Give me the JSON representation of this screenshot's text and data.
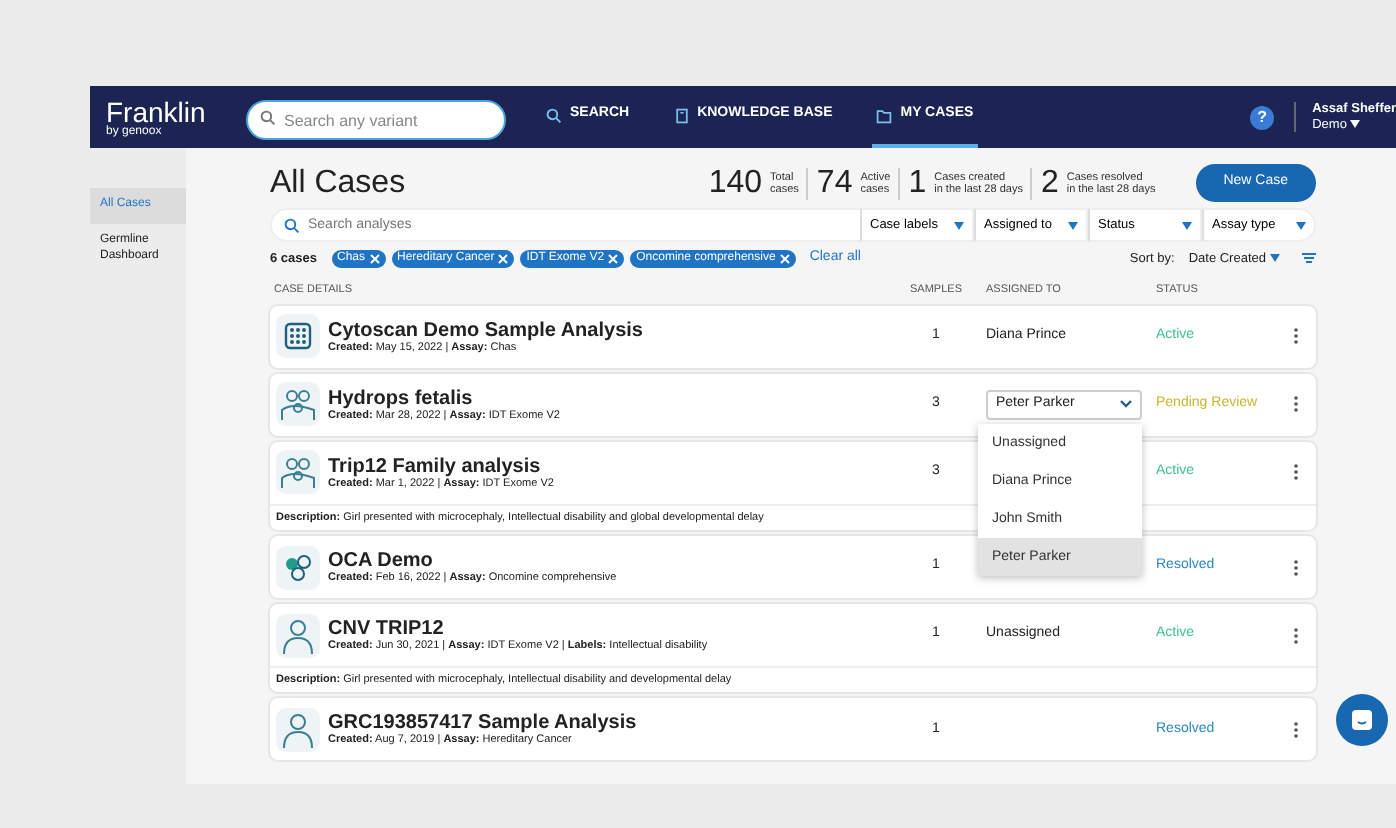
{
  "navbar": {
    "logo": "Franklin",
    "logo_sub": "by genoox",
    "search": {
      "placeholder": "Search any variant"
    },
    "items": [
      {
        "label": "SEARCH",
        "selected": false
      },
      {
        "label": "KNOWLEDGE BASE",
        "selected": false
      },
      {
        "label": "MY CASES",
        "selected": true
      }
    ],
    "help": "?",
    "user": {
      "name": "Assaf Sheffer",
      "org": "Demo"
    }
  },
  "sidebar": {
    "items": [
      {
        "label": "All Cases",
        "selected": true
      },
      {
        "label": "Germline Dashboard",
        "selected": false
      }
    ]
  },
  "title": "All Cases",
  "stats": [
    {
      "value": "140",
      "label": [
        "Total",
        "cases"
      ]
    },
    {
      "value": "74",
      "label": [
        "Active",
        "cases"
      ]
    },
    {
      "value": "1",
      "label": [
        "Cases created",
        "in the last 28 days"
      ]
    },
    {
      "value": "2",
      "label": [
        "Cases resolved",
        "in the last 28 days"
      ]
    }
  ],
  "new_button": "New Case",
  "search": {
    "placeholder": "Search analyses"
  },
  "filters": [
    "Case labels",
    "Assigned to",
    "Status",
    "Assay type"
  ],
  "count": "6 cases",
  "chips": [
    "Chas",
    "Hereditary Cancer",
    "IDT Exome V2",
    "Oncomine comprehensive"
  ],
  "clear_all": "Clear all",
  "sort": {
    "label": "Sort by:",
    "value": "Date Created"
  },
  "columns": [
    "CASE DETAILS",
    "SAMPLES",
    "ASSIGNED TO",
    "STATUS"
  ],
  "rows": [
    {
      "kind": "chip",
      "title": "Cytoscan Demo Sample Analysis",
      "meta": "**Created:** May 15, 2022 | **Assay:** Chas",
      "samples": "1",
      "assigned": {
        "kind": "text",
        "text": "Diana Prince"
      },
      "status": "Active",
      "color": "#3fbf95"
    },
    {
      "kind": "family",
      "title": "Hydrops fetalis",
      "meta": "**Created:** Mar 28, 2022 | **Assay:** IDT Exome V2",
      "samples": "3",
      "assigned": {
        "kind": "dropdown",
        "text": "Peter Parker"
      },
      "status": "Pending Review",
      "color": "#c7b62c",
      "menu": [
        {
          "label": "Unassigned",
          "selected": false
        },
        {
          "label": "Diana Prince",
          "selected": false
        },
        {
          "label": "John Smith",
          "selected": false
        },
        {
          "label": "Peter Parker",
          "selected": true
        }
      ]
    },
    {
      "kind": "family",
      "title": "Trip12 Family analysis",
      "meta": "**Created:** Mar 1, 2022 | **Assay:** IDT Exome V2",
      "samples": "3",
      "status": "Active",
      "color": "#3fbf95",
      "description": "**Description:** Girl presented with microcephaly, Intellectual disability and global developmental delay"
    },
    {
      "kind": "cells",
      "title": "OCA Demo",
      "meta": "**Created:** Feb 16, 2022 | **Assay:** Oncomine comprehensive",
      "samples": "1",
      "status": "Resolved",
      "color": "#2b86c5"
    },
    {
      "kind": "person",
      "title": "CNV TRIP12",
      "meta": "**Created:** Jun 30, 2021 | **Assay:** IDT Exome V2 | **Labels:** Intellectual disability",
      "samples": "1",
      "assigned": {
        "kind": "text",
        "text": "Unassigned"
      },
      "status": "Active",
      "color": "#3fbf95",
      "description": "**Description:** Girl presented with microcephaly, Intellectual disability and developmental delay"
    },
    {
      "kind": "person",
      "title": "GRC193857417 Sample Analysis",
      "meta": "**Created:** Aug 7, 2019 | **Assay:** Hereditary Cancer",
      "samples": "1",
      "status": "Resolved",
      "color": "#2b86c5"
    }
  ]
}
